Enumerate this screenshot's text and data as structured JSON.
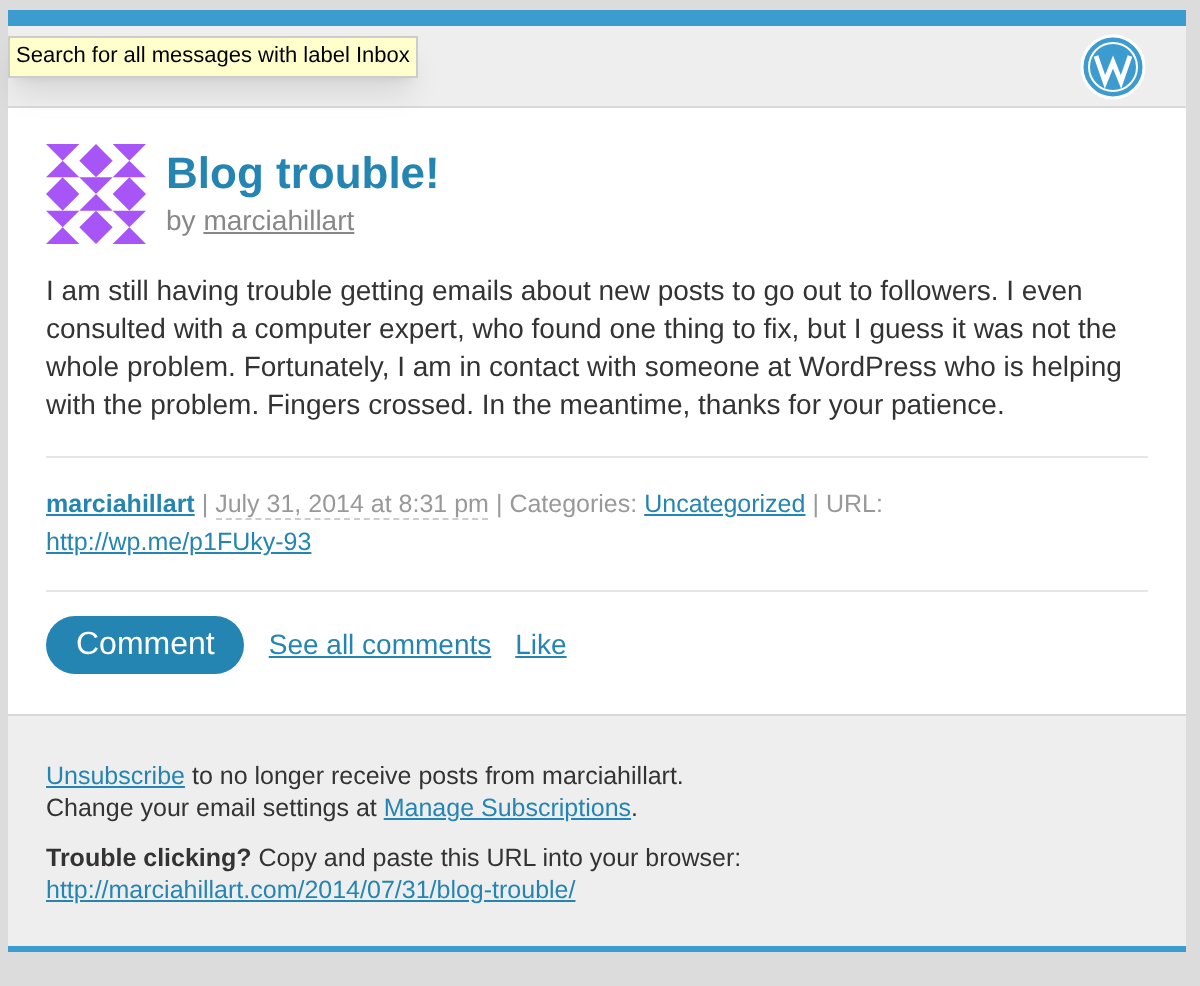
{
  "tooltip": {
    "text": "Search for all messages with label Inbox"
  },
  "post": {
    "title": "Blog trouble!",
    "by": "by",
    "author": "marciahillart",
    "body": "I am still having trouble getting emails about new posts to go out to followers. I even consulted with a computer expert, who found one thing to fix, but I guess it was not the whole problem. Fortunately, I am in contact with someone at WordPress who is helping with the problem. Fingers crossed. In the meantime, thanks for your patience."
  },
  "meta": {
    "author": "marciahillart",
    "separator": "|",
    "date": "July 31, 2014 at 8:31 pm",
    "categories_label": "Categories:",
    "category": "Uncategorized",
    "url_label": "URL:",
    "url": "http://wp.me/p1FUky-93"
  },
  "actions": {
    "comment_button": "Comment",
    "links": [
      "See all comments",
      "Like"
    ]
  },
  "footer": {
    "unsubscribe_link": "Unsubscribe",
    "unsubscribe_text": "to no longer receive posts from marciahillart.",
    "settings_text": "Change your email settings at",
    "settings_link": "Manage Subscriptions",
    "settings_end": ".",
    "trouble_bold": "Trouble clicking?",
    "trouble_text": "Copy and paste this URL into your browser:",
    "post_url": "http://marciahillart.com/2014/07/31/blog-trouble/"
  }
}
